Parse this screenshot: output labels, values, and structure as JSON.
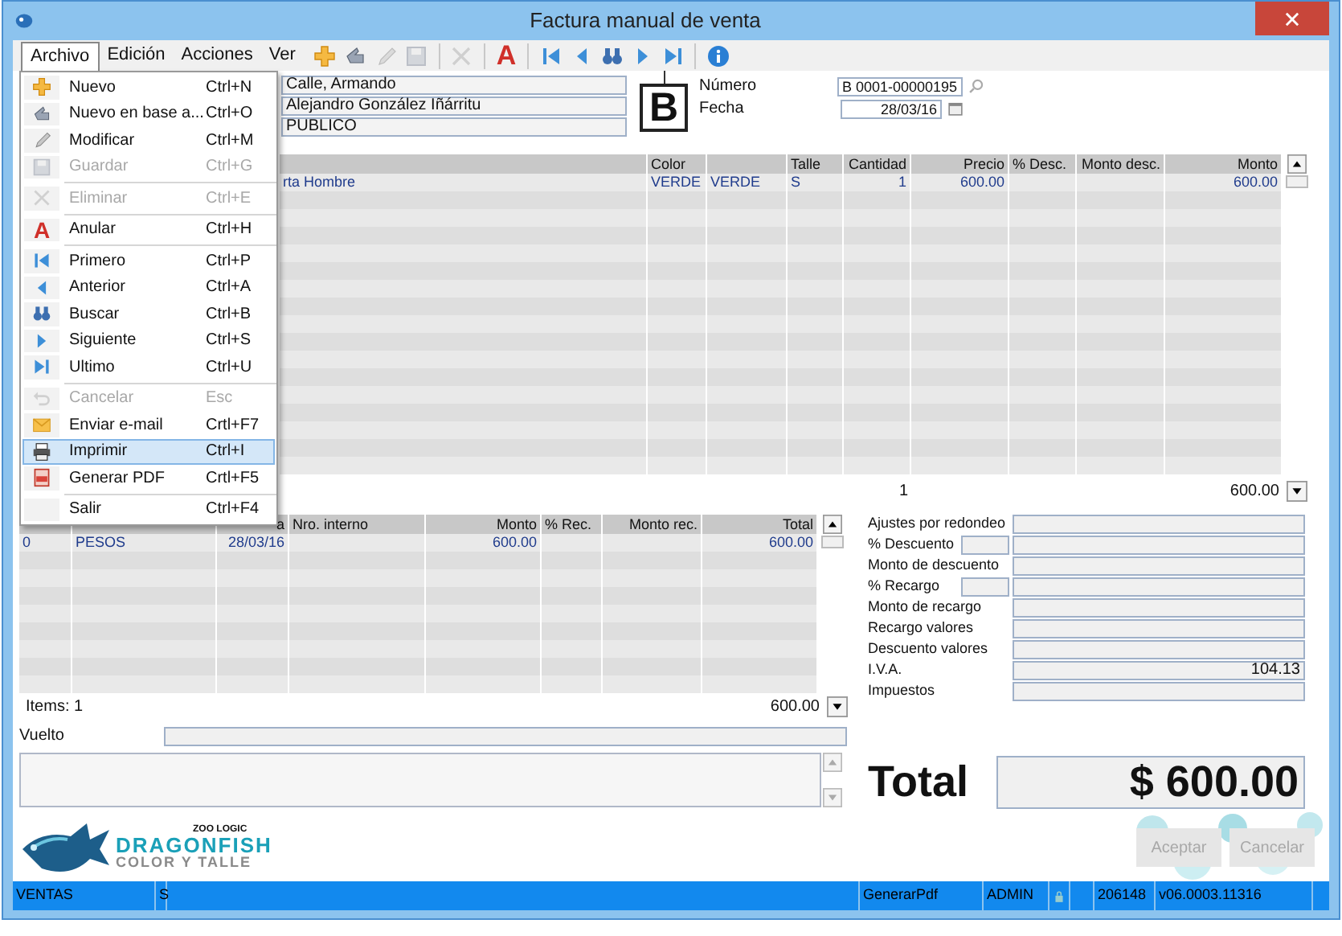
{
  "window": {
    "title": "Factura manual de venta"
  },
  "menubar": [
    {
      "label": "Archivo",
      "selected": true
    },
    {
      "label": "Edición",
      "selected": false
    },
    {
      "label": "Acciones",
      "selected": false
    },
    {
      "label": "Ver",
      "selected": false
    }
  ],
  "toolbar": [
    {
      "kind": "icon"
    },
    {
      "kind": "icon"
    },
    {
      "kind": "icon",
      "disabled": true
    },
    {
      "kind": "icon",
      "disabled": true
    },
    {
      "kind": "separator"
    },
    {
      "kind": "icon",
      "disabled": true
    },
    {
      "kind": "separator"
    },
    {
      "kind": "glyph",
      "text": "A"
    },
    {
      "kind": "separator"
    },
    {
      "kind": "icon"
    },
    {
      "kind": "icon"
    },
    {
      "kind": "icon"
    },
    {
      "kind": "icon"
    },
    {
      "kind": "icon"
    },
    {
      "kind": "separator"
    },
    {
      "kind": "icon"
    }
  ],
  "menu": [
    {
      "label": "Nuevo",
      "shortcut": "Ctrl+N",
      "disabled": false,
      "selected": false
    },
    {
      "label": "Nuevo en base a...",
      "shortcut": "Ctrl+O",
      "disabled": false,
      "selected": false
    },
    {
      "label": "Modificar",
      "shortcut": "Ctrl+M",
      "disabled": false,
      "selected": false
    },
    {
      "label": "Guardar",
      "shortcut": "Ctrl+G",
      "disabled": true,
      "selected": false
    },
    {
      "label": "Eliminar",
      "shortcut": "Ctrl+E",
      "disabled": true,
      "selected": false,
      "separator_before": true
    },
    {
      "label": "Anular",
      "shortcut": "Ctrl+H",
      "disabled": false,
      "selected": false,
      "separator_before": true,
      "glyph": "A"
    },
    {
      "label": "Primero",
      "shortcut": "Ctrl+P",
      "disabled": false,
      "selected": false,
      "separator_before": true
    },
    {
      "label": "Anterior",
      "shortcut": "Ctrl+A",
      "disabled": false,
      "selected": false
    },
    {
      "label": "Buscar",
      "shortcut": "Ctrl+B",
      "disabled": false,
      "selected": false
    },
    {
      "label": "Siguiente",
      "shortcut": "Ctrl+S",
      "disabled": false,
      "selected": false
    },
    {
      "label": "Ultimo",
      "shortcut": "Ctrl+U",
      "disabled": false,
      "selected": false
    },
    {
      "label": "Cancelar",
      "shortcut": "Esc",
      "disabled": true,
      "selected": false,
      "separator_before": true
    },
    {
      "label": "Enviar e-mail",
      "shortcut": "Crtl+F7",
      "disabled": false,
      "selected": false
    },
    {
      "label": "Imprimir",
      "shortcut": "Ctrl+I",
      "disabled": false,
      "selected": true
    },
    {
      "label": "Generar PDF",
      "shortcut": "Crtl+F5",
      "disabled": false,
      "selected": false
    },
    {
      "label": "Salir",
      "shortcut": "Ctrl+F4",
      "disabled": false,
      "selected": false,
      "separator_before": true
    }
  ],
  "header_fields": [
    "Calle, Armando",
    "Alejandro González Iñárritu",
    "PUBLICO"
  ],
  "invoice_letter": "B",
  "numero": {
    "label": "Número",
    "value": "B 0001-00000195"
  },
  "fecha": {
    "label": "Fecha",
    "value": "28/03/16"
  },
  "items_grid": {
    "columns": [
      null,
      null,
      "Color",
      null,
      "Talle",
      "Cantidad",
      "Precio",
      "% Desc.",
      "Monto desc.",
      "Monto"
    ],
    "rows": [
      [
        null,
        "rta Hombre",
        "VERDE",
        "VERDE",
        "S",
        "1",
        "600.00",
        null,
        null,
        "600.00"
      ]
    ],
    "totals": {
      "cantidad": "1",
      "monto": "600.00"
    }
  },
  "payments_grid": {
    "columns": [
      null,
      null,
      "a",
      "Nro. interno",
      "Monto",
      "% Rec.",
      "Monto rec.",
      "Total"
    ],
    "rows": [
      [
        "0",
        "PESOS",
        "28/03/16",
        null,
        "600.00",
        null,
        null,
        "600.00"
      ]
    ],
    "items_label": "Items: 1",
    "total": "600.00"
  },
  "vuelto": {
    "label": "Vuelto"
  },
  "summary": [
    {
      "label": "Ajustes por redondeo",
      "kind": "amount"
    },
    {
      "label": "% Descuento",
      "kind": "rate"
    },
    {
      "label": "Monto de descuento",
      "kind": "amount"
    },
    {
      "label": "% Recargo",
      "kind": "rate"
    },
    {
      "label": "Monto de recargo",
      "kind": "amount"
    },
    {
      "label": "Recargo valores",
      "kind": "amount"
    },
    {
      "label": "Descuento valores",
      "kind": "amount"
    },
    {
      "label": "I.V.A.",
      "kind": "amount",
      "value": "104.13"
    },
    {
      "label": "Impuestos",
      "kind": "amount"
    }
  ],
  "total": {
    "label": "Total",
    "value": "$ 600.00"
  },
  "logo": {
    "brand": "ZOO LOGIC",
    "name": "DRAGONFISH",
    "tagline": "COLOR Y TALLE"
  },
  "buttons": [
    {
      "label": "Aceptar",
      "disabled": true
    },
    {
      "label": "Cancelar",
      "disabled": true
    }
  ],
  "status_bar": [
    {
      "kind": "text",
      "text": "VENTAS"
    },
    {
      "kind": "text",
      "text": "S"
    },
    {
      "kind": "text",
      "text": "GenerarPdf"
    },
    {
      "kind": "text",
      "text": "ADMIN"
    },
    {
      "kind": "lock"
    },
    {
      "kind": "text",
      "text": "206148"
    },
    {
      "kind": "text",
      "text": "v06.0003.11316"
    }
  ]
}
